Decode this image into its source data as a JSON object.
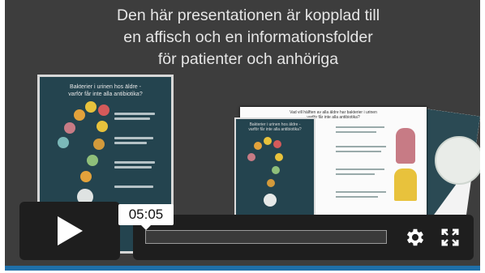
{
  "slide": {
    "title": "Den här presentationen är kopplad till\nen affisch och en informationsfolder\nför patienter och anhöriga",
    "poster_title": "Bakterier i urinen hos äldre -\nvarför får inte alla antibiotika?",
    "folder_title": "Vad vill hälften av alla äldre har bakterier i urinen\nvarför får inte alla antibiotika?",
    "folder_front_title": "Bakterier i urinen hos äldre -\nvarför får inte alla antibiotika?"
  },
  "player": {
    "timestamp": "05:05",
    "progress": 0.0,
    "play_icon": "play-icon",
    "settings_icon": "gear-icon",
    "fullscreen_icon": "fullscreen-icon"
  },
  "colors": {
    "background": "#3d3d3d",
    "poster": "#24444f",
    "controls": "#1e1e1e",
    "accent_strip": "#1f6fa8"
  }
}
